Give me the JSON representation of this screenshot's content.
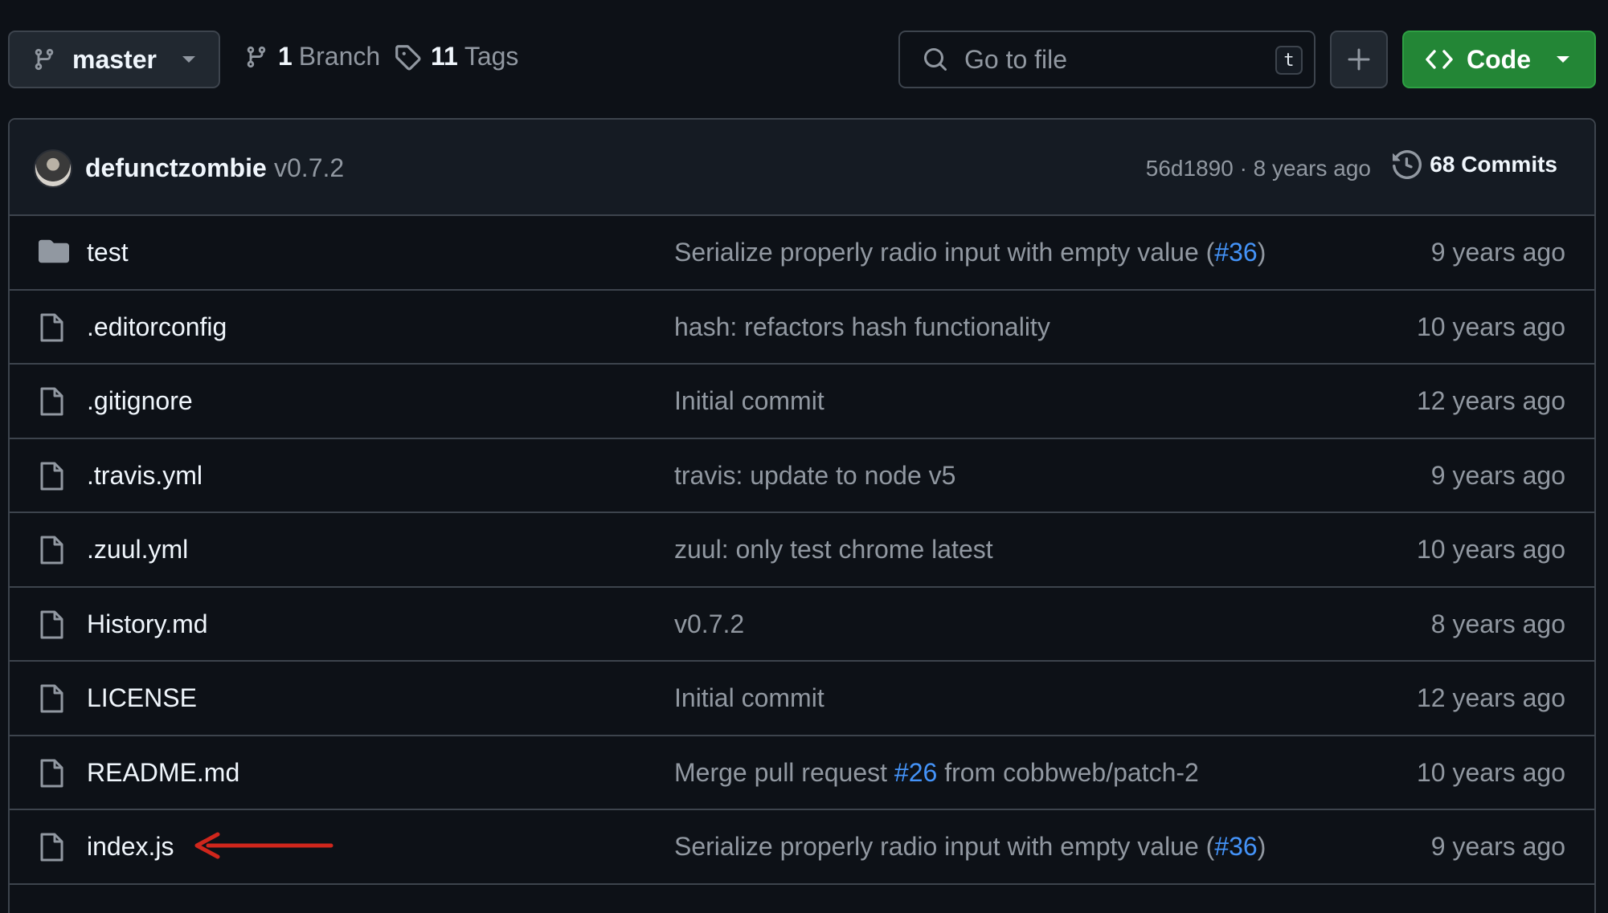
{
  "toolbar": {
    "branch": "master",
    "branches_count": "1",
    "branches_label": "Branch",
    "tags_count": "11",
    "tags_label": "Tags",
    "search_placeholder": "Go to file",
    "search_shortcut": "t",
    "code_label": "Code"
  },
  "latest_commit": {
    "author": "defunctzombie",
    "message": "v0.7.2",
    "info": "56d1890 · 8 years ago",
    "commits_label": "68 Commits"
  },
  "files": [
    {
      "name": "test",
      "type": "folder",
      "message": "Serialize properly radio input with empty value (",
      "pr": "#36",
      "message_tail": ")",
      "age": "9 years ago"
    },
    {
      "name": ".editorconfig",
      "type": "file",
      "message": "hash: refactors hash functionality",
      "pr": "",
      "message_tail": "",
      "age": "10 years ago"
    },
    {
      "name": ".gitignore",
      "type": "file",
      "message": "Initial commit",
      "pr": "",
      "message_tail": "",
      "age": "12 years ago"
    },
    {
      "name": ".travis.yml",
      "type": "file",
      "message": "travis: update to node v5",
      "pr": "",
      "message_tail": "",
      "age": "9 years ago"
    },
    {
      "name": ".zuul.yml",
      "type": "file",
      "message": "zuul: only test chrome latest",
      "pr": "",
      "message_tail": "",
      "age": "10 years ago"
    },
    {
      "name": "History.md",
      "type": "file",
      "message": "v0.7.2",
      "pr": "",
      "message_tail": "",
      "age": "8 years ago"
    },
    {
      "name": "LICENSE",
      "type": "file",
      "message": "Initial commit",
      "pr": "",
      "message_tail": "",
      "age": "12 years ago"
    },
    {
      "name": "README.md",
      "type": "file",
      "message": "Merge pull request ",
      "pr": "#26",
      "message_tail": " from cobbweb/patch-2",
      "age": "10 years ago"
    },
    {
      "name": "index.js",
      "type": "file",
      "message": "Serialize properly radio input with empty value (",
      "pr": "#36",
      "message_tail": ")",
      "age": "9 years ago"
    }
  ],
  "colors": {
    "background": "#0d1117",
    "border": "#3d444d",
    "link": "#4493f8",
    "code_button": "#238636",
    "annotation_arrow": "#d0261c"
  }
}
